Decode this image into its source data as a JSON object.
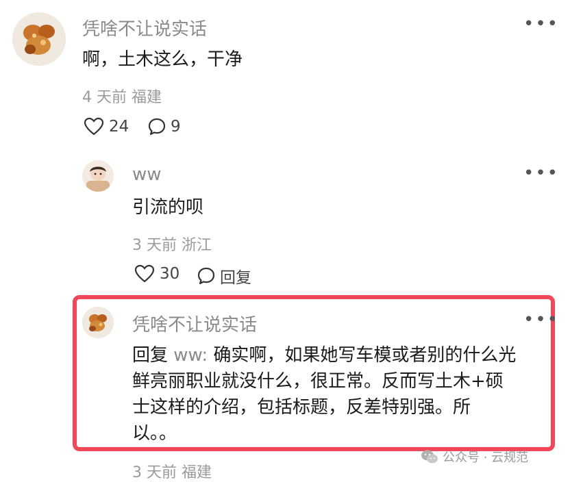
{
  "comment": {
    "username": "凭啥不让说实话",
    "content": "啊，土木这么，干净",
    "time_location": "4 天前 福建",
    "likes": "24",
    "comments": "9"
  },
  "reply1": {
    "username": "ww",
    "content": "引流的呗",
    "time_location": "3 天前 浙江",
    "likes": "30",
    "reply_label": "回复"
  },
  "reply2": {
    "username": "凭啥不让说实话",
    "reply_prefix_word": "回复",
    "reply_target": "ww:",
    "lines": [
      "确实啊，如果她写车模或者别的什么光",
      "鲜亮丽职业就没什么，很正常。反而写土木+硕",
      "士这样的介绍，包括标题，反差特别强。所",
      "以。。"
    ],
    "time_location": "3 天前 福建"
  },
  "watermark": {
    "text": "公众号 · 云规范"
  },
  "colors": {
    "highlight_border": "#f0485a",
    "muted_text": "#8a8a8a"
  }
}
